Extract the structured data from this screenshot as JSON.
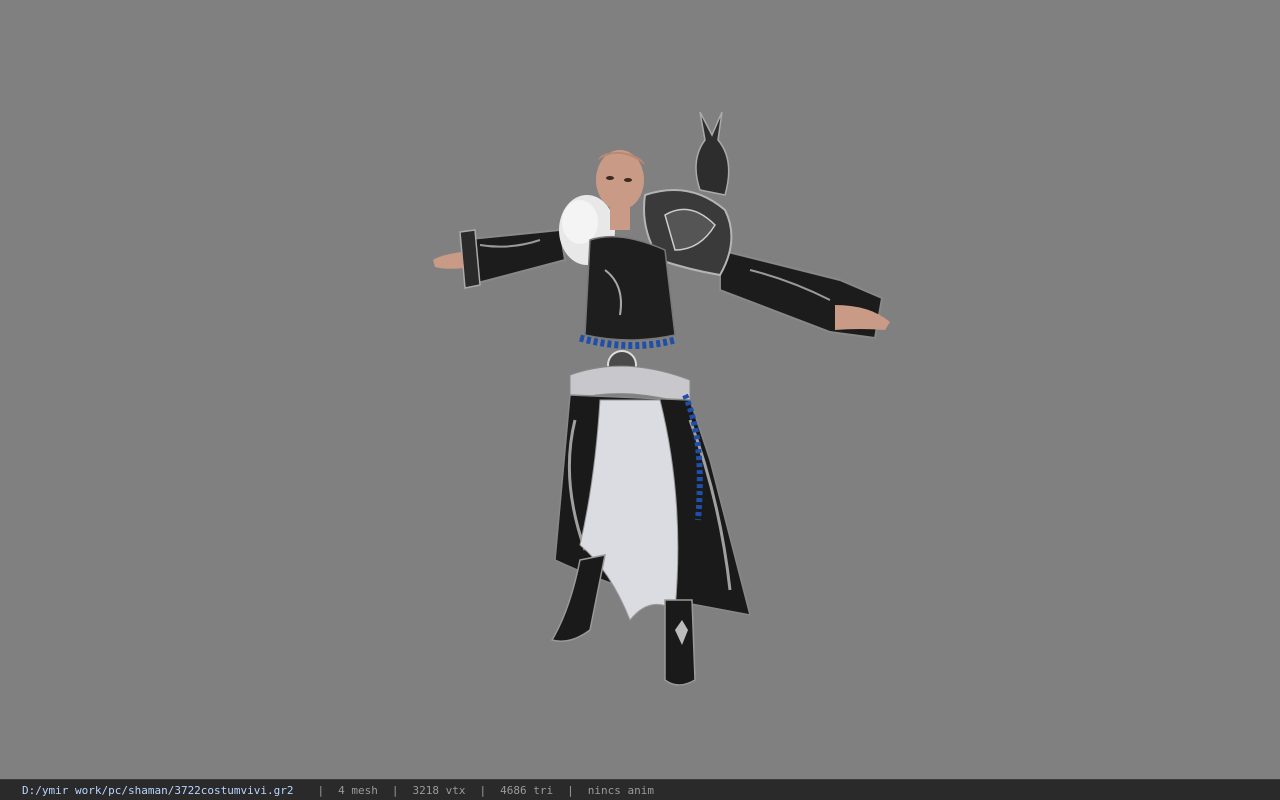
{
  "viewer": {
    "background_color": "#808080",
    "model_subject": "shaman-costume-character"
  },
  "statusbar": {
    "file_path": "D:/ymir work/pc/shaman/3722costumvivi.gr2",
    "separator": "|",
    "mesh_count": "4 mesh",
    "vertex_count": "3218 vtx",
    "triangle_count": "4686 tri",
    "anim_status": "nincs anim",
    "path_color": "#b8d4ff"
  }
}
